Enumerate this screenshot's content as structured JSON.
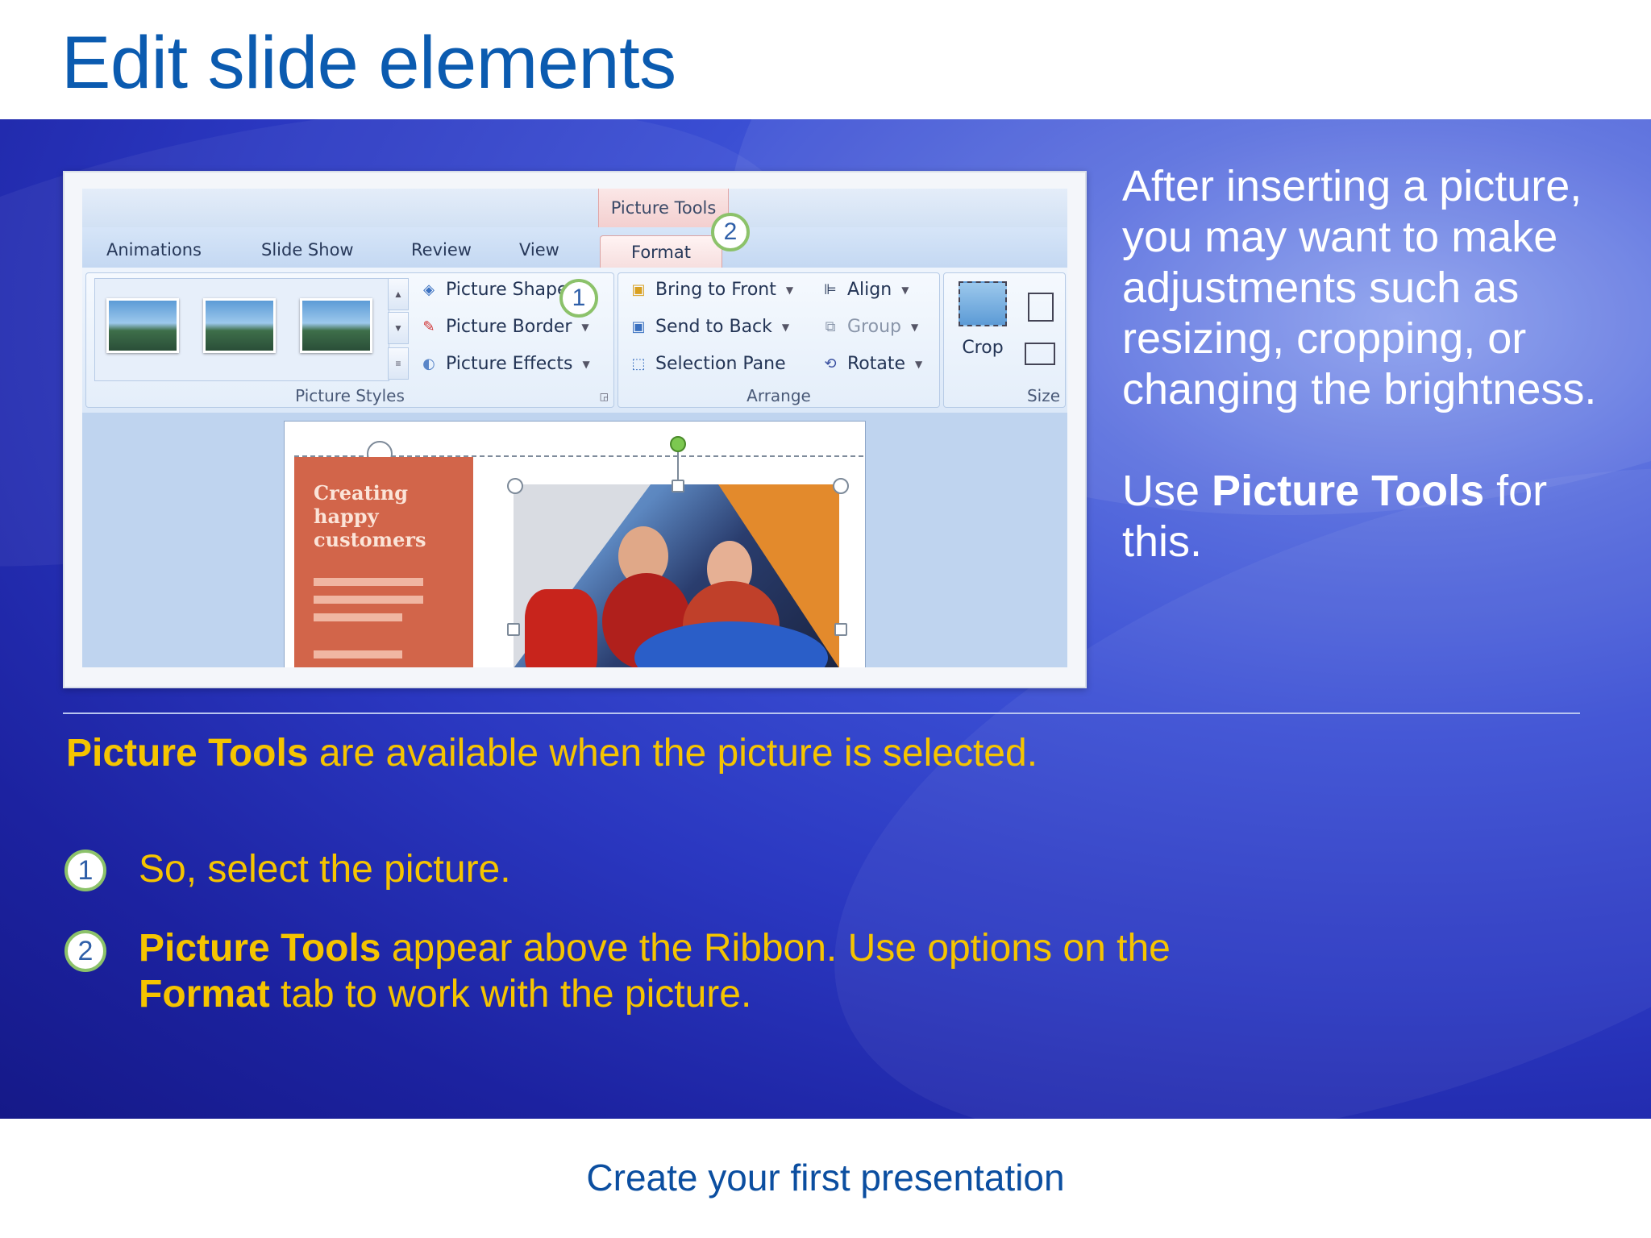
{
  "title": "Edit slide elements",
  "footer": "Create your first presentation",
  "ribbon": {
    "context_tab": "Picture Tools",
    "tabs": [
      "Animations",
      "Slide Show",
      "Review",
      "View",
      "Format"
    ],
    "groups": {
      "picture_styles": {
        "label": "Picture Styles",
        "commands": [
          "Picture Shape",
          "Picture Border",
          "Picture Effects"
        ]
      },
      "arrange": {
        "label": "Arrange",
        "commands": [
          "Bring to Front",
          "Send to Back",
          "Selection Pane",
          "Align",
          "Group",
          "Rotate"
        ]
      },
      "size": {
        "label": "Size",
        "commands": [
          "Crop"
        ]
      }
    }
  },
  "slide_preview": {
    "title_text": "Creating\nhappy\ncustomers"
  },
  "callouts": [
    "1",
    "2"
  ],
  "right_panel": {
    "paragraph1": "After inserting a picture, you may want to make adjustments such as resizing, cropping, or changing the brightness.",
    "p2_prefix": "Use ",
    "p2_bold": "Picture Tools",
    "p2_suffix": " for this."
  },
  "notes": {
    "intro_bold": "Picture Tools",
    "intro_rest": " are available when the picture is selected.",
    "steps": [
      {
        "number": "1",
        "text": "So, select the picture."
      },
      {
        "number": "2",
        "bold1": "Picture Tools",
        "text1": " appear above the Ribbon. Use options on the ",
        "bold2": "Format",
        "text2": " tab to work with the picture."
      }
    ]
  },
  "colors": {
    "title": "#0b5bb0",
    "accent_yellow": "#f5c400",
    "background_blue": "#2a37c0",
    "callout_ring": "#8cc26a"
  }
}
